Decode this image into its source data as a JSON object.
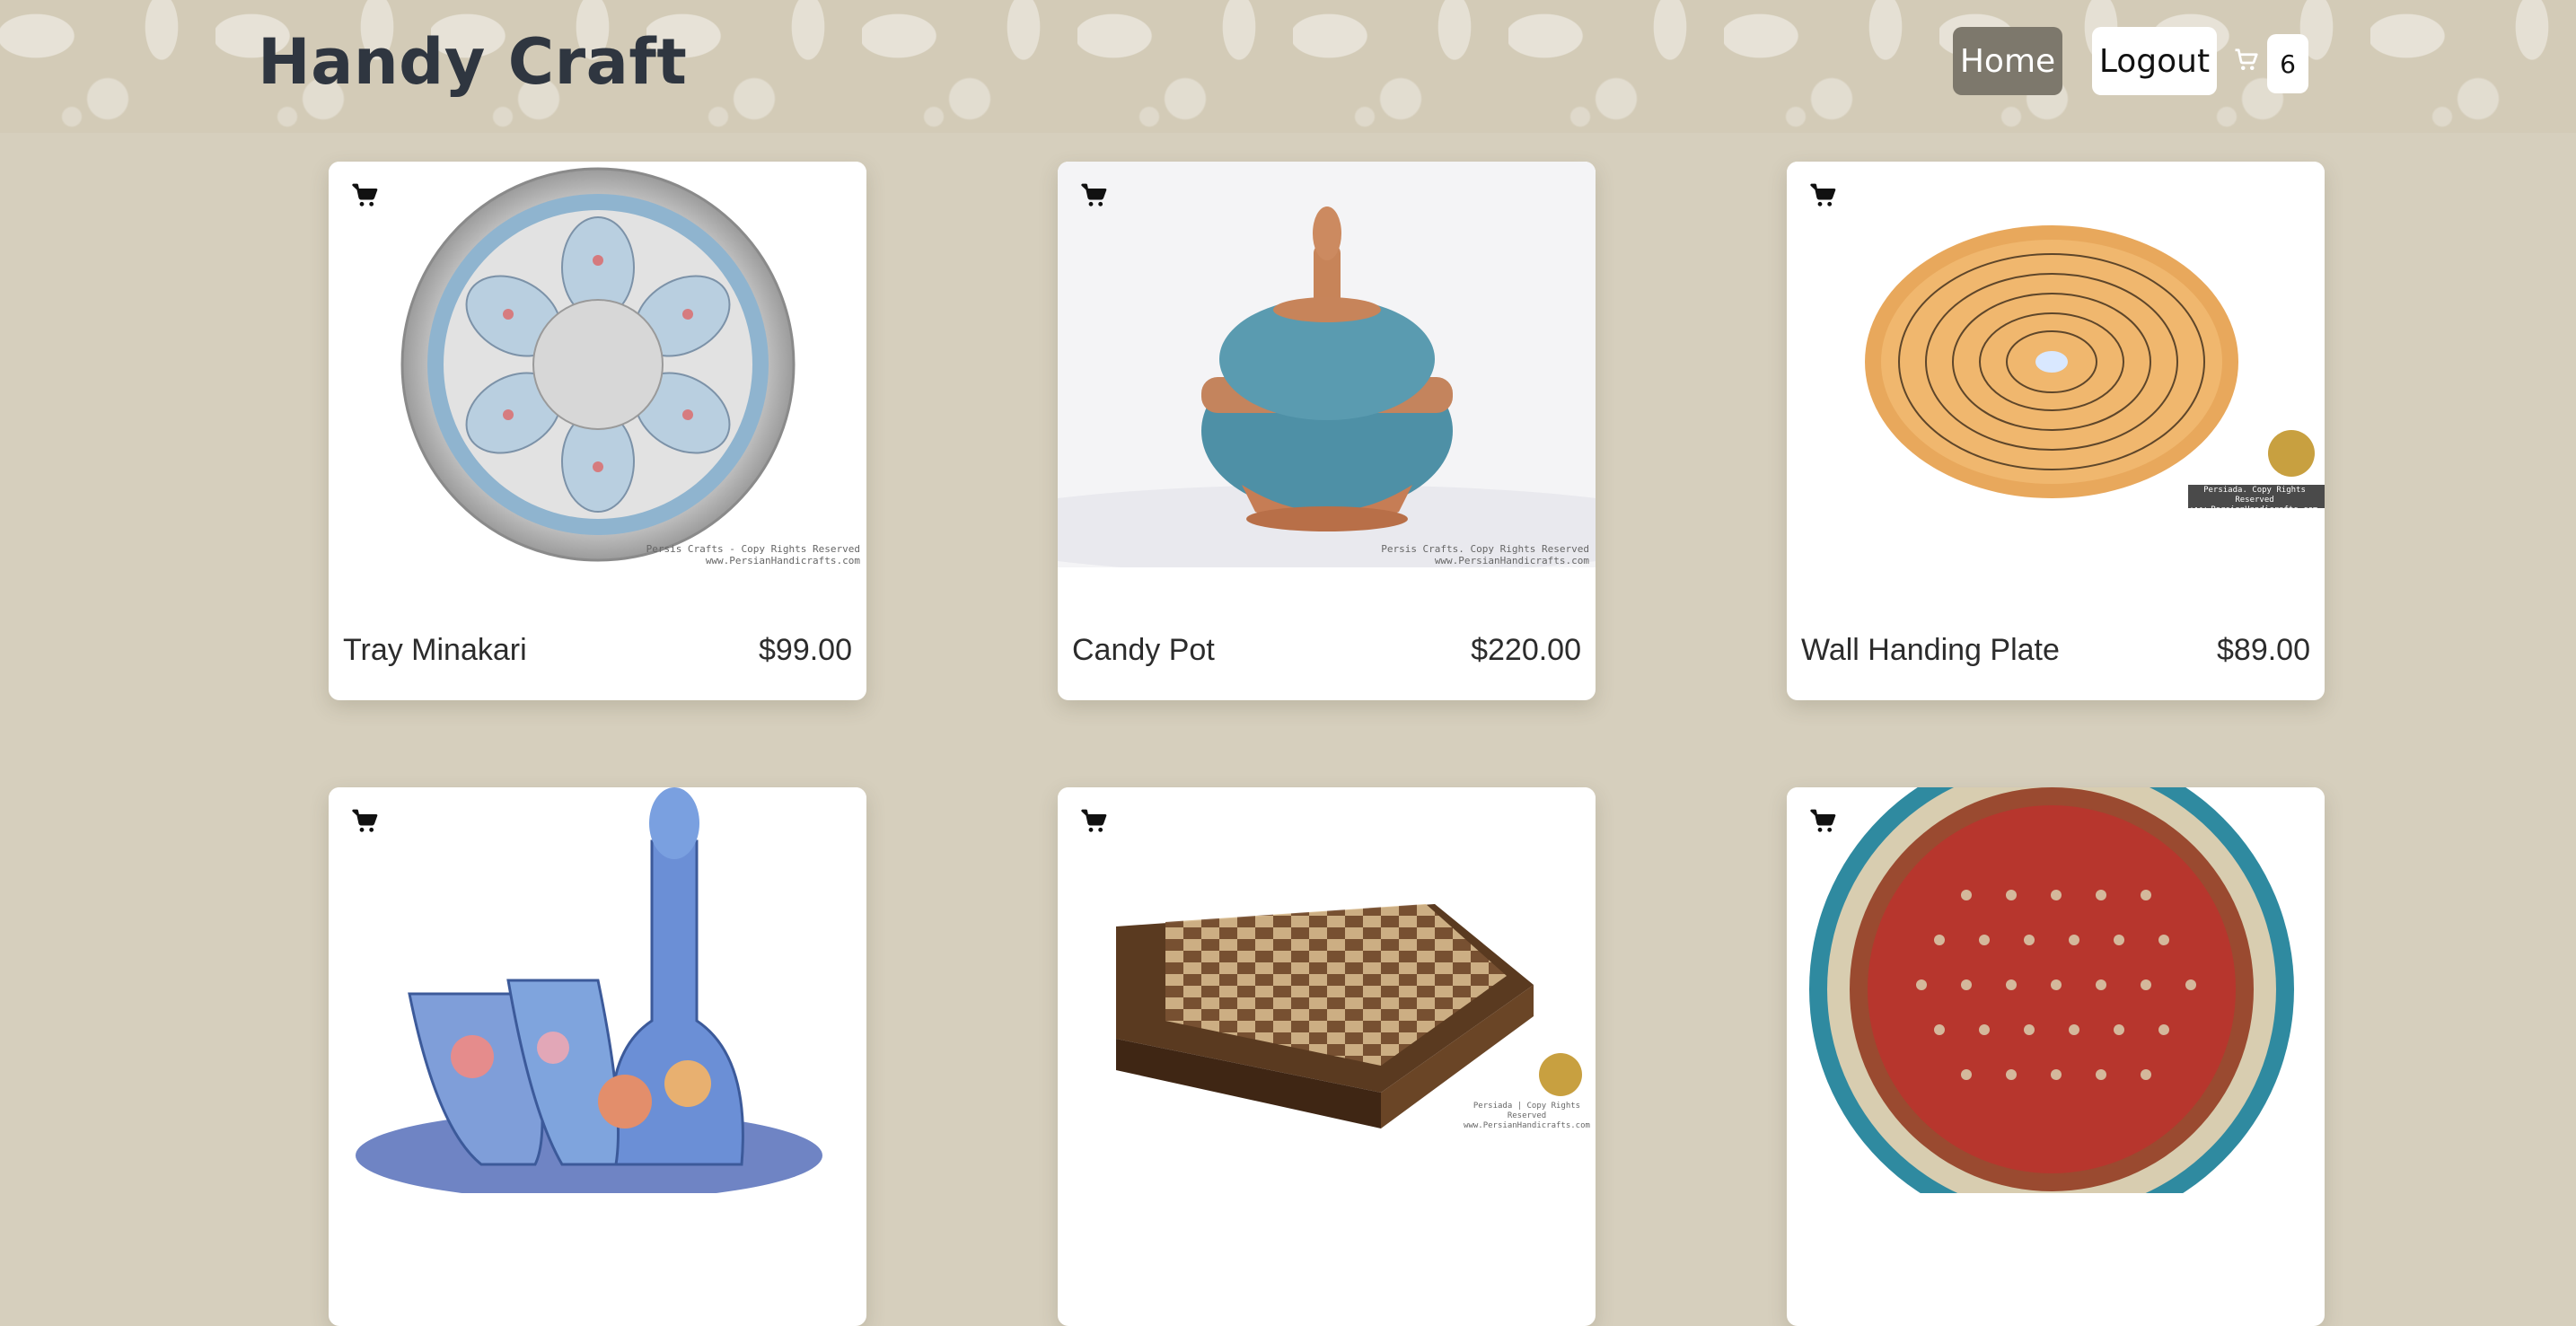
{
  "header": {
    "brand": "Handy Craft",
    "nav": {
      "home_label": "Home",
      "logout_label": "Logout"
    },
    "cart_count": "6"
  },
  "products": [
    {
      "name": "Tray Minakari",
      "price": "$99.00",
      "watermark": "Persis Crafts - Copy Rights Reserved\nwww.PersianHandicrafts.com"
    },
    {
      "name": "Candy Pot",
      "price": "$220.00",
      "watermark": "Persis Crafts. Copy Rights Reserved\nwww.PersianHandicrafts.com"
    },
    {
      "name": "Wall Handing Plate",
      "price": "$89.00",
      "watermark": "Persiada. Copy Rights Reserved\nwww.PersianHandicrafts.com"
    },
    {
      "name": "",
      "price": "",
      "watermark": ""
    },
    {
      "name": "",
      "price": "",
      "watermark": "Persiada | Copy Rights Reserved\nwww.PersianHandicrafts.com"
    },
    {
      "name": "",
      "price": "",
      "watermark": ""
    }
  ],
  "colors": {
    "background": "#d6cfbd",
    "header_bg": "#d3cbb7",
    "brand_text": "#2f3640",
    "home_button": "#7d786c",
    "card_bg": "#ffffff"
  },
  "icons": {
    "cart": "shopping-cart-icon"
  }
}
